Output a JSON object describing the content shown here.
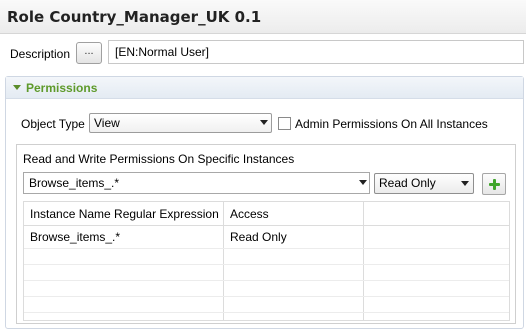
{
  "title": "Role Country_Manager_UK 0.1",
  "description": {
    "label": "Description",
    "button_label": "...",
    "value": "[EN:Normal User]"
  },
  "permissions": {
    "section_title": "Permissions",
    "object_type_label": "Object Type",
    "object_type_value": "View",
    "admin_checkbox_label": "Admin Permissions On All Instances",
    "admin_checked": false,
    "group_label": "Read and Write Permissions On Specific Instances",
    "instance_input_value": "Browse_items_.*",
    "access_value": "Read Only",
    "add_icon": "plus-icon",
    "table": {
      "headers": [
        "Instance Name Regular Expression",
        "Access"
      ],
      "rows": [
        [
          "Browse_items_.*",
          "Read Only"
        ]
      ]
    }
  },
  "colors": {
    "section_title": "#5e9a2b",
    "add_icon": "#3fa52a"
  }
}
